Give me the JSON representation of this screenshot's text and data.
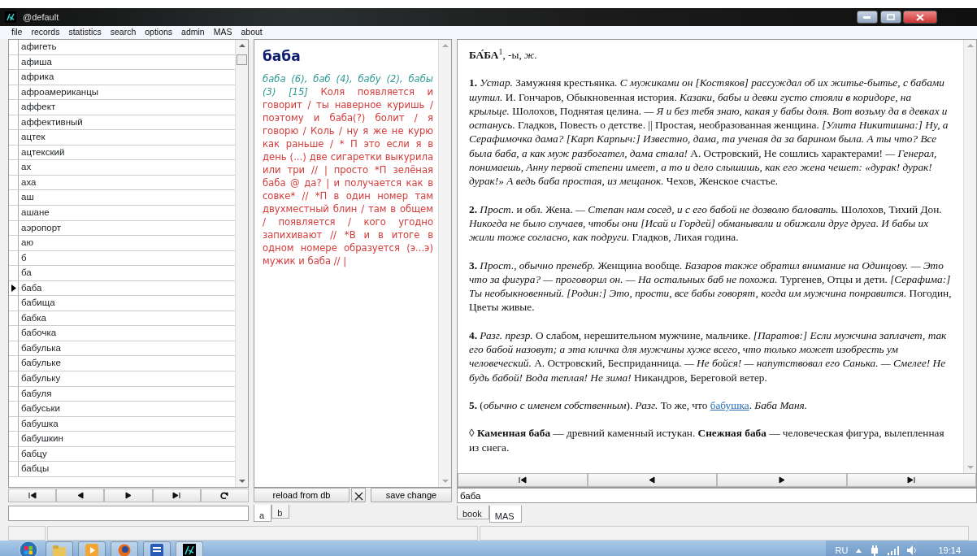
{
  "window": {
    "title": "@default"
  },
  "menu": [
    {
      "label": "file"
    },
    {
      "label": "records"
    },
    {
      "label": "statistics"
    },
    {
      "label": "search"
    },
    {
      "label": "options"
    },
    {
      "label": "admin"
    },
    {
      "label": "MAS"
    },
    {
      "label": "about"
    }
  ],
  "word_list": {
    "items": [
      {
        "label": "афигеть",
        "selected": false
      },
      {
        "label": "афиша",
        "selected": false
      },
      {
        "label": "африка",
        "selected": false
      },
      {
        "label": "афроамериканцы",
        "selected": false
      },
      {
        "label": "аффект",
        "selected": false
      },
      {
        "label": "аффективный",
        "selected": false
      },
      {
        "label": "ацтек",
        "selected": false
      },
      {
        "label": "ацтекский",
        "selected": false
      },
      {
        "label": "ах",
        "selected": false
      },
      {
        "label": "аха",
        "selected": false
      },
      {
        "label": "аш",
        "selected": false
      },
      {
        "label": "ашане",
        "selected": false
      },
      {
        "label": "аэропорт",
        "selected": false
      },
      {
        "label": "аю",
        "selected": false
      },
      {
        "label": "б",
        "selected": false
      },
      {
        "label": "ба",
        "selected": false
      },
      {
        "label": "баба",
        "selected": true
      },
      {
        "label": "бабища",
        "selected": false
      },
      {
        "label": "бабка",
        "selected": false
      },
      {
        "label": "бабочка",
        "selected": false
      },
      {
        "label": "бабулька",
        "selected": false
      },
      {
        "label": "бабульке",
        "selected": false
      },
      {
        "label": "бабульку",
        "selected": false
      },
      {
        "label": "бабуля",
        "selected": false
      },
      {
        "label": "бабуськи",
        "selected": false
      },
      {
        "label": "бабушка",
        "selected": false
      },
      {
        "label": "бабушкин",
        "selected": false
      },
      {
        "label": "бабцу",
        "selected": false
      },
      {
        "label": "бабцы",
        "selected": false
      }
    ]
  },
  "entry": {
    "headword": "баба",
    "forms": "баба (6), баб (4), бабу (2), бабы (3) [15]",
    "transcript": "Коля появляется и говорит / ты наверное куришь / поэтому и баба(?) болит / я говорю / Коль / ну я же не курю как раньше / * П это если я в день (...) две сигаретки выкурила или три // | просто *П зелёная баба @ да? | и получается как в совке* // *П в один номер там двухместный блин / там в общем / появляется / кого угодно запихивают // *В и в итоге в одном номере образуется (э...э) мужик и баба // |"
  },
  "entry_buttons": [
    {
      "label": "reload from db"
    },
    {
      "label": "save change"
    }
  ],
  "entry_tabs": [
    {
      "label": "a",
      "selected": true
    },
    {
      "label": "b",
      "selected": false
    }
  ],
  "dictionary": {
    "heading": "**БА́БА**$^{1}$, -ы, *ж.*",
    "paragraphs": [
      {
        "kind": "text",
        "text": "**1.** *Устар.* Замужняя крестьянка. *С мужиками он [Костяков] рассуждал об их житье-бытье, с бабами шутил.* И. Гончаров, Обыкновенная история. *Казаки, бабы и девки густо стояли в коридоре, на крыльце.* Шолохов, Поднятая целина. *— Я и без тебя знаю, какая у бабы доля. Вот возьму да в девках и останусь.* Гладков, Повесть о детстве. || Простая, необразованная женщина. *[Улита Никитишна:] Ну, а Серафимочка дама? [Карп Карпыч:] Известно, дама, та ученая да за барином была. А ты что? Все была баба, а как муж разбогател, дама стала!* А. Островский, Не сошлись характерами! *— Генерал, понимаешь, Анну первой степени имеет, а то и дело слышишь, как его жена чешет: «дурак! дурак! дурак!» А ведь баба простая, из мещанок.* Чехов, Женское счастье."
      },
      {
        "kind": "text",
        "text": "**2.** *Прост.* и *обл.* Жена. *— Степан нам сосед, и с его бабой не дозволю баловать.* Шолохов, Тихий Дон. *Никогда не было случаев, чтобы они [Исай и Гордей] обманывали и обижали друг друга. И бабы их жили тоже согласно, как подруги.* Гладков, Лихая година."
      },
      {
        "kind": "text",
        "text": "**3.** *Прост., обычно пренебр.* Женщина вообще. *Базаров также обратил внимание на Одинцову. — Это что за фигура? — проговорил он. — На остальных баб не похожа.* Тургенев, Отцы и дети. *[Серафима:] Ты необыкновенный. [Родин:] Это, прости, все бабы говорят, когда им мужчина понравится.* Погодин, Цветы живые."
      },
      {
        "kind": "text",
        "text": "**4.** *Разг. презр.* О слабом, нерешительном мужчине, мальчике. *[Паратов:] Если мужчина заплачет, так его бабой назовут; а эта кличка для мужчины хуже всего, что только может изобресть ум человеческий.* А. Островский, Бесприданница. *— Не бойся! — напутствовал его Санька. — Смелее! Не будь бабой! Вода теплая! Не зима!* Никандров, Береговой ветер."
      },
      {
        "kind": "link",
        "before": "**5.** (*обычно с именем собственным*). *Разг.* То же, что ",
        "link": "бабушка",
        "after": ". *Баба Маня.*"
      },
      {
        "kind": "text",
        "text": "◊ **Каменная баба** — древний каменный истукан. **Снежная баба** — человеческая фигура, вылепленная из снега."
      }
    ]
  },
  "search": {
    "value": "баба"
  },
  "dict_tabs": [
    {
      "label": "book",
      "selected": false
    },
    {
      "label": "MAS",
      "selected": true
    }
  ],
  "taskbar": {
    "language": "RU",
    "clock": "19:14"
  }
}
